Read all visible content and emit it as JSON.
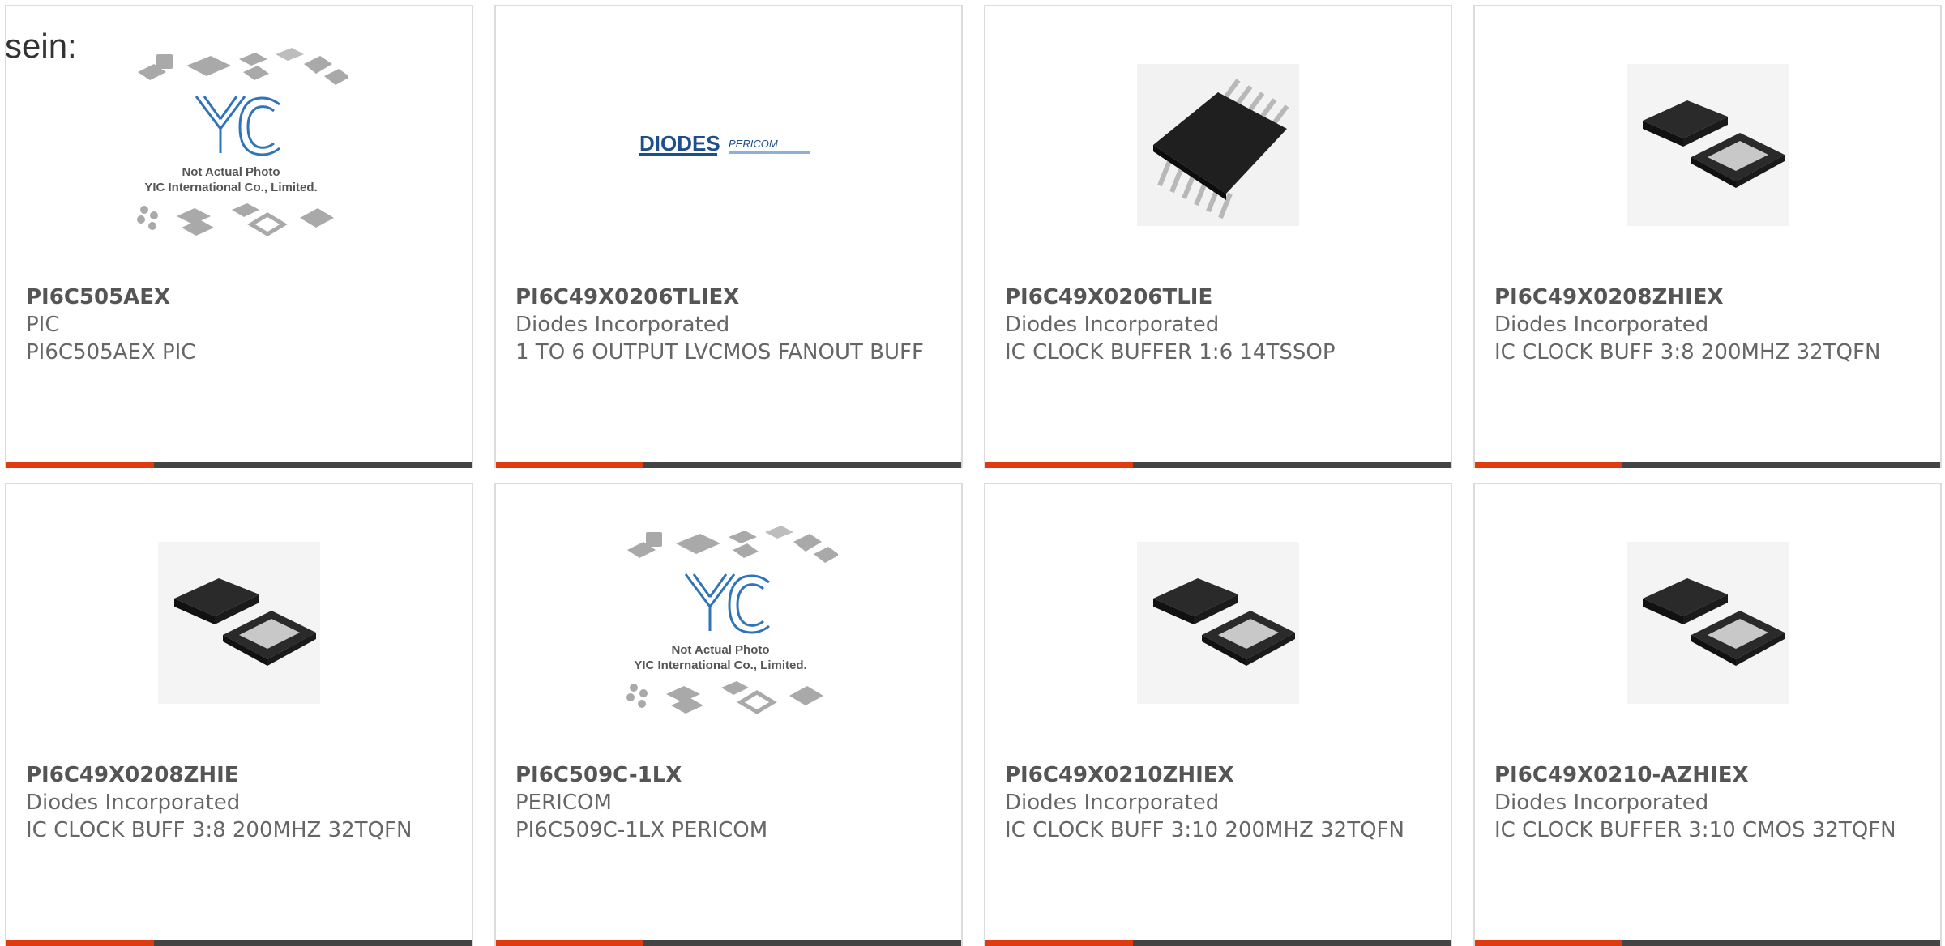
{
  "page": {
    "intro_text": "sein:"
  },
  "colors": {
    "accent": "#e03a10",
    "bar_dark": "#444444",
    "border": "#dcdcdc",
    "text": "#666666"
  },
  "products": [
    {
      "part_number": "PI6C505AEX",
      "manufacturer": "PIC",
      "description": "PI6C505AEX PIC",
      "image": "yic-placeholder-photo",
      "image_caption_1": "Not Actual Photo",
      "image_caption_2": "YIC International Co., Limited."
    },
    {
      "part_number": "PI6C49X0206TLIEX",
      "manufacturer": "Diodes Incorporated",
      "description": "1 TO 6 OUTPUT LVCMOS FANOUT BUFF",
      "image": "diodes-pericom-logo",
      "logo_text_1": "DIODES",
      "logo_text_2": "PERICOM"
    },
    {
      "part_number": "PI6C49X0206TLIE",
      "manufacturer": "Diodes Incorporated",
      "description": "IC CLOCK BUFFER 1:6 14TSSOP",
      "image": "tssop-chip-photo"
    },
    {
      "part_number": "PI6C49X0208ZHIEX",
      "manufacturer": "Diodes Incorporated",
      "description": "IC CLOCK BUFF 3:8 200MHZ 32TQFN",
      "image": "tqfn-chip-photo"
    },
    {
      "part_number": "PI6C49X0208ZHIE",
      "manufacturer": "Diodes Incorporated",
      "description": "IC CLOCK BUFF 3:8 200MHZ 32TQFN",
      "image": "tqfn-chip-photo"
    },
    {
      "part_number": "PI6C509C-1LX",
      "manufacturer": "PERICOM",
      "description": "PI6C509C-1LX PERICOM",
      "image": "yic-placeholder-photo",
      "image_caption_1": "Not Actual Photo",
      "image_caption_2": "YIC International Co., Limited."
    },
    {
      "part_number": "PI6C49X0210ZHIEX",
      "manufacturer": "Diodes Incorporated",
      "description": "IC CLOCK BUFF 3:10 200MHZ 32TQFN",
      "image": "tqfn-chip-photo"
    },
    {
      "part_number": "PI6C49X0210-AZHIEX",
      "manufacturer": "Diodes Incorporated",
      "description": "IC CLOCK BUFFER 3:10 CMOS 32TQFN",
      "image": "tqfn-chip-photo"
    }
  ]
}
